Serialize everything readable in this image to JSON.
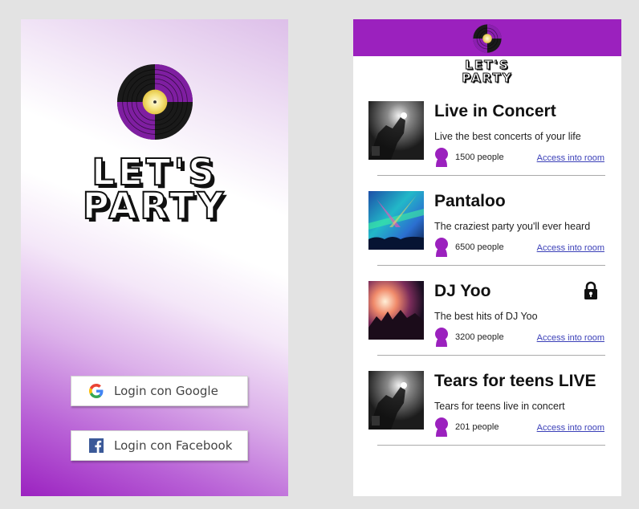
{
  "login": {
    "logo_line1": "LET'S",
    "logo_line2": "PARTY",
    "google_label": "Login con Google",
    "facebook_label": "Login con Facebook"
  },
  "list": {
    "header_logo_line1": "LET'S",
    "header_logo_line2": "PARTY",
    "rooms": [
      {
        "title": "Live in Concert",
        "description": "Live the best concerts of your life",
        "people": "1500 people",
        "access": "Access into room",
        "locked": false,
        "thumb": "concert-bw"
      },
      {
        "title": "Pantaloo",
        "description": "The craziest party you'll ever heard",
        "people": "6500 people",
        "access": "Access into room",
        "locked": false,
        "thumb": "festival-color"
      },
      {
        "title": "DJ Yoo",
        "description": "The best hits of DJ Yoo",
        "people": "3200 people",
        "access": "Access into room",
        "locked": true,
        "thumb": "dj-crowd"
      },
      {
        "title": "Tears for teens LIVE",
        "description": "Tears for teens live in concert",
        "people": "201 people",
        "access": "Access into room",
        "locked": false,
        "thumb": "concert-bw"
      }
    ]
  },
  "colors": {
    "accent": "#9b21be",
    "link": "#3a3fb8"
  },
  "icons": {
    "logo": "vinyl-record-icon",
    "google": "google-g-icon",
    "facebook": "facebook-f-icon",
    "people": "person-icon",
    "lock": "lock-icon"
  }
}
